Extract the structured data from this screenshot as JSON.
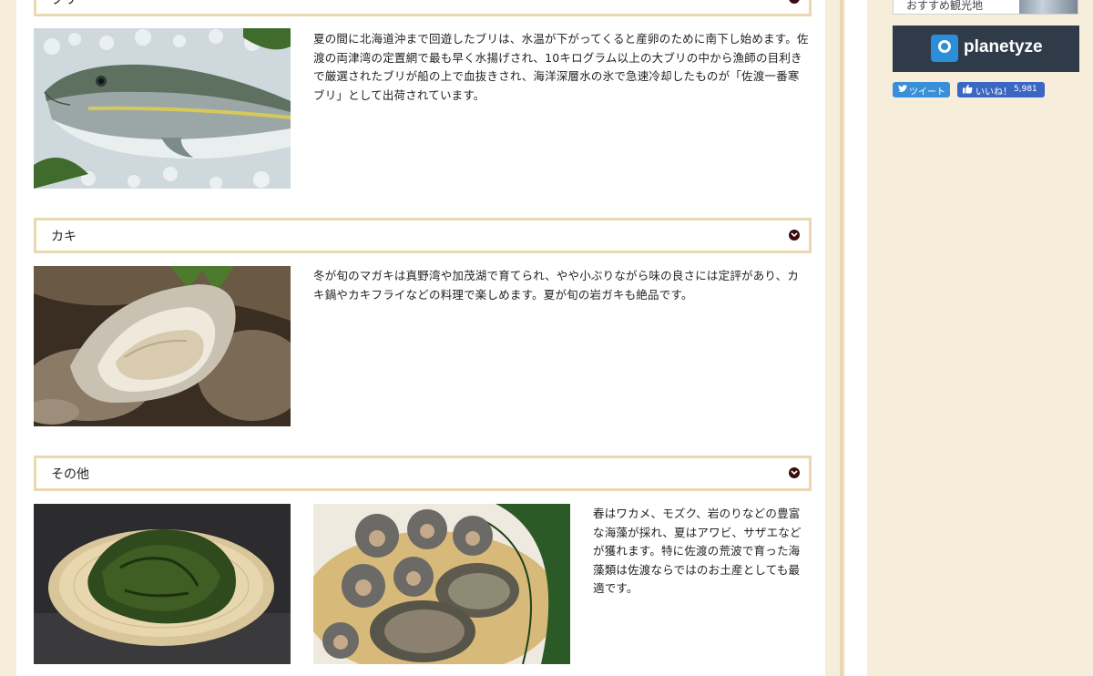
{
  "sections": [
    {
      "title": "ブリ",
      "description": "夏の間に北海道沖まで回遊したブリは、水温が下がってくると産卵のために南下し始めます。佐渡の両津湾の定置網で最も早く水揚げされ、10キログラム以上の大ブリの中から漁師の目利きで厳選されたブリが船の上で血抜きされ、海洋深層水の氷で急速冷却したものが「佐渡一番寒ブリ」として出荷されています。"
    },
    {
      "title": "カキ",
      "description": "冬が旬のマガキは真野湾や加茂湖で育てられ、やや小ぶりながら味の良さには定評があり、カキ鍋やカキフライなどの料理で楽しめます。夏が旬の岩ガキも絶品です。"
    },
    {
      "title": "その他",
      "description": "春はワカメ、モズク、岩のりなどの豊富な海藻が採れ、夏はアワビ、サザエなどが獲れます。特に佐渡の荒波で育った海藻類は佐渡ならではのお土産としても最適です。"
    }
  ],
  "sidebar": {
    "recommend_label": "おすすめ観光地",
    "planetyze_label": "planetyze",
    "tweet_label": "ツイート",
    "like_label": "いいね！",
    "like_count": "5,981"
  },
  "icons": {
    "chevron": "chevron-down-circle-icon",
    "twitter": "twitter-bird-icon",
    "like": "thumbs-up-icon"
  },
  "colors": {
    "page_bg": "#f6eedb",
    "header_border": "#ead8b0",
    "chevron": "#3b0c0c",
    "tweet": "#3a8fd9",
    "like": "#3b66c4",
    "planetyze_bg": "#2f3b49"
  }
}
